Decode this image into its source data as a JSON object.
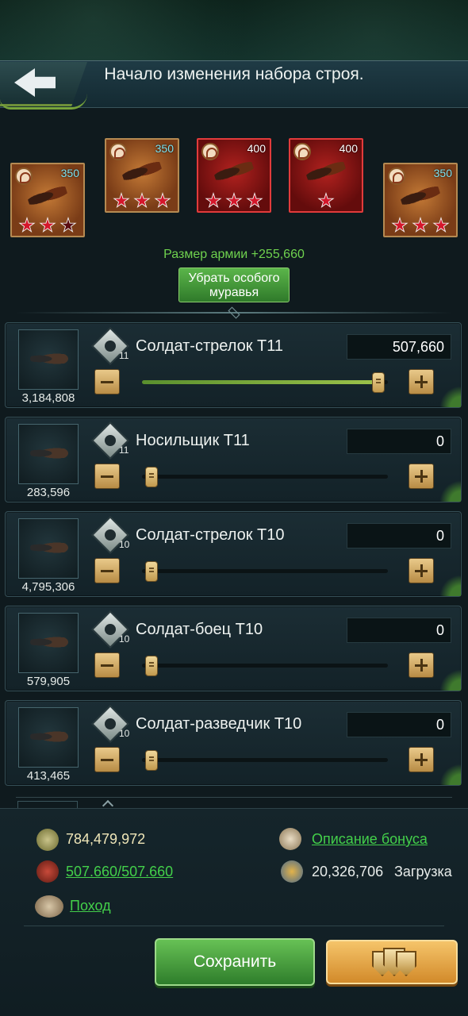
{
  "header": {
    "title": "Начало изменения набора строя."
  },
  "special_ants": [
    {
      "level": "350",
      "stars": 2,
      "max_stars": 3,
      "highlight": false
    },
    {
      "level": "350",
      "stars": 3,
      "max_stars": 3,
      "highlight": false
    },
    {
      "level": "400",
      "stars": 3,
      "max_stars": 3,
      "highlight": true
    },
    {
      "level": "400",
      "stars": 1,
      "max_stars": 1,
      "highlight": true
    },
    {
      "level": "350",
      "stars": 3,
      "max_stars": 3,
      "highlight": false
    }
  ],
  "army_size": "Размер армии +255,660",
  "remove_button": "Убрать особого муравья",
  "troops": [
    {
      "name": "Солдат-стрелок T11",
      "tier": "11",
      "owned": "3,184,808",
      "quantity": "507,660",
      "fill": 1.0
    },
    {
      "name": "Носильщик T11",
      "tier": "11",
      "owned": "283,596",
      "quantity": "0",
      "fill": 0
    },
    {
      "name": "Солдат-стрелок T10",
      "tier": "10",
      "owned": "4,795,306",
      "quantity": "0",
      "fill": 0
    },
    {
      "name": "Солдат-боец T10",
      "tier": "10",
      "owned": "579,905",
      "quantity": "0",
      "fill": 0
    },
    {
      "name": "Солдат-разведчик T10",
      "tier": "10",
      "owned": "413,465",
      "quantity": "0",
      "fill": 0
    }
  ],
  "bottom": {
    "power": "784,479,972",
    "bonus_link": "Описание бонуса",
    "troops_count": "507.660/507.660",
    "load_value": "20,326,706",
    "load_label": "Загрузка",
    "march_link": "Поход",
    "save_label": "Сохранить"
  },
  "colors": {
    "accent_green": "#43d04a",
    "army_green": "#6fd24e",
    "gold": "#d28a2a",
    "star_red": "#d5172b"
  },
  "icons": {
    "back": "back-arrow-icon",
    "power": "crossed-swords-icon",
    "bonus": "bar-chart-icon",
    "troops": "ant-icon",
    "load": "load-bug-icon",
    "march": "snail-icon",
    "formation": "shield-icon"
  }
}
